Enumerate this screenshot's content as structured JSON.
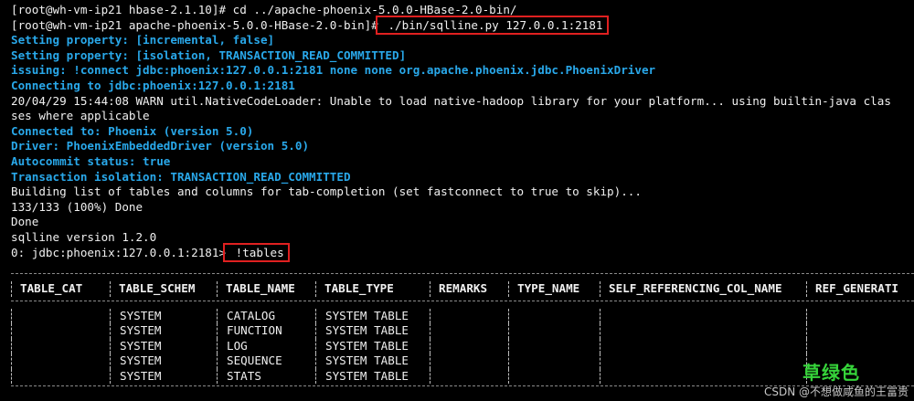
{
  "terminal": {
    "lines": [
      {
        "text": "[root@wh-vm-ip21 hbase-2.1.10]# cd ../apache-phoenix-5.0.0-HBase-2.0-bin/",
        "style": "white"
      },
      {
        "prompt": "[root@wh-vm-ip21 apache-phoenix-5.0.0-HBase-2.0-bin]#",
        "command": " ./bin/sqlline.py 127.0.0.1:2181",
        "highlight": true
      },
      {
        "text": "Setting property: [incremental, false]",
        "style": "blue"
      },
      {
        "text": "Setting property: [isolation, TRANSACTION_READ_COMMITTED]",
        "style": "blue"
      },
      {
        "text": "issuing: !connect jdbc:phoenix:127.0.0.1:2181 none none org.apache.phoenix.jdbc.PhoenixDriver",
        "style": "blue"
      },
      {
        "text": "Connecting to jdbc:phoenix:127.0.0.1:2181",
        "style": "blue"
      },
      {
        "text": "20/04/29 15:44:08 WARN util.NativeCodeLoader: Unable to load native-hadoop library for your platform... using builtin-java clas",
        "style": "white"
      },
      {
        "text": "ses where applicable",
        "style": "white"
      },
      {
        "text": "Connected to: Phoenix (version 5.0)",
        "style": "blue"
      },
      {
        "text": "Driver: PhoenixEmbeddedDriver (version 5.0)",
        "style": "blue"
      },
      {
        "text": "Autocommit status: true",
        "style": "blue"
      },
      {
        "text": "Transaction isolation: TRANSACTION_READ_COMMITTED",
        "style": "blue"
      },
      {
        "text": "Building list of tables and columns for tab-completion (set fastconnect to true to skip)...",
        "style": "white"
      },
      {
        "text": "133/133 (100%) Done",
        "style": "white"
      },
      {
        "text": "Done",
        "style": "white"
      },
      {
        "text": "sqlline version 1.2.0",
        "style": "white"
      },
      {
        "prompt": "0: jdbc:phoenix:127.0.0.1:2181>",
        "command": " !tables",
        "highlight": true
      }
    ]
  },
  "table": {
    "headers": [
      "TABLE_CAT",
      "TABLE_SCHEM",
      "TABLE_NAME",
      "TABLE_TYPE",
      "REMARKS",
      "TYPE_NAME",
      "SELF_REFERENCING_COL_NAME",
      "REF_GENERATI"
    ],
    "rows": [
      [
        "",
        "SYSTEM",
        "CATALOG",
        "SYSTEM TABLE",
        "",
        "",
        "",
        ""
      ],
      [
        "",
        "SYSTEM",
        "FUNCTION",
        "SYSTEM TABLE",
        "",
        "",
        "",
        ""
      ],
      [
        "",
        "SYSTEM",
        "LOG",
        "SYSTEM TABLE",
        "",
        "",
        "",
        ""
      ],
      [
        "",
        "SYSTEM",
        "SEQUENCE",
        "SYSTEM TABLE",
        "",
        "",
        "",
        ""
      ],
      [
        "",
        "SYSTEM",
        "STATS",
        "SYSTEM TABLE",
        "",
        "",
        "",
        ""
      ]
    ]
  },
  "overlay": {
    "stamp_text": "草绿色",
    "watermark_text": "CSDN @不想做咸鱼的王富贵"
  },
  "colors": {
    "background": "#000000",
    "text": "#f0f0f0",
    "info_blue": "#29a8ea",
    "highlight_box": "#e02020",
    "stamp_green": "#36d43a"
  }
}
